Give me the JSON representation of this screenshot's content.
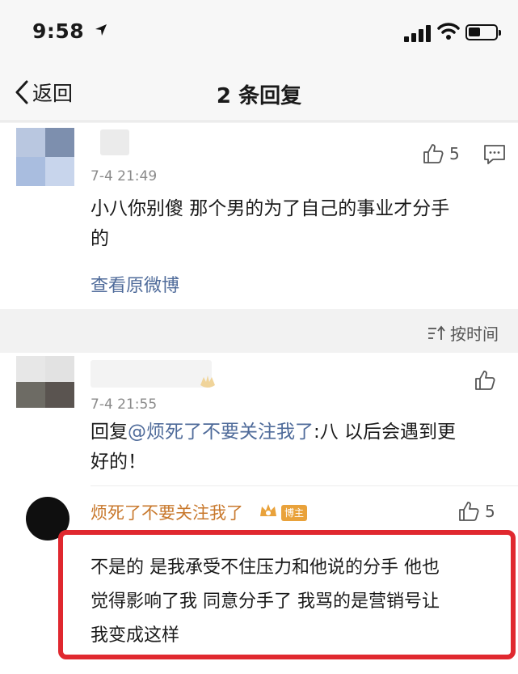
{
  "status_bar": {
    "time": "9:58"
  },
  "nav": {
    "back_label": "返回",
    "title": "2 条回复"
  },
  "root_comment": {
    "time": "7-4 21:49",
    "like_count": "5",
    "text_line1": "小八你别傻 那个男的为了自己的事业才分手",
    "text_line2": "的",
    "view_original": "查看原微博"
  },
  "sort": {
    "label": "按时间"
  },
  "reply_1": {
    "time": "7-4 21:55",
    "prefix": "回复",
    "mention": "@烦死了不要关注我了",
    "text_line1_rest": ":八 以后会遇到更",
    "text_line2": "好的！"
  },
  "reply_2": {
    "name": "烦死了不要关注我了",
    "badge": "博主",
    "like_count": "5",
    "text_line1": "不是的 是我承受不住压力和他说的分手 他也",
    "text_line2": "觉得影响了我 同意分手了 我骂的是营销号让",
    "text_line3": "我变成这样"
  },
  "colors": {
    "link": "#4f6b9a",
    "name_orange": "#c8782c",
    "highlight_red": "#e0282f"
  }
}
